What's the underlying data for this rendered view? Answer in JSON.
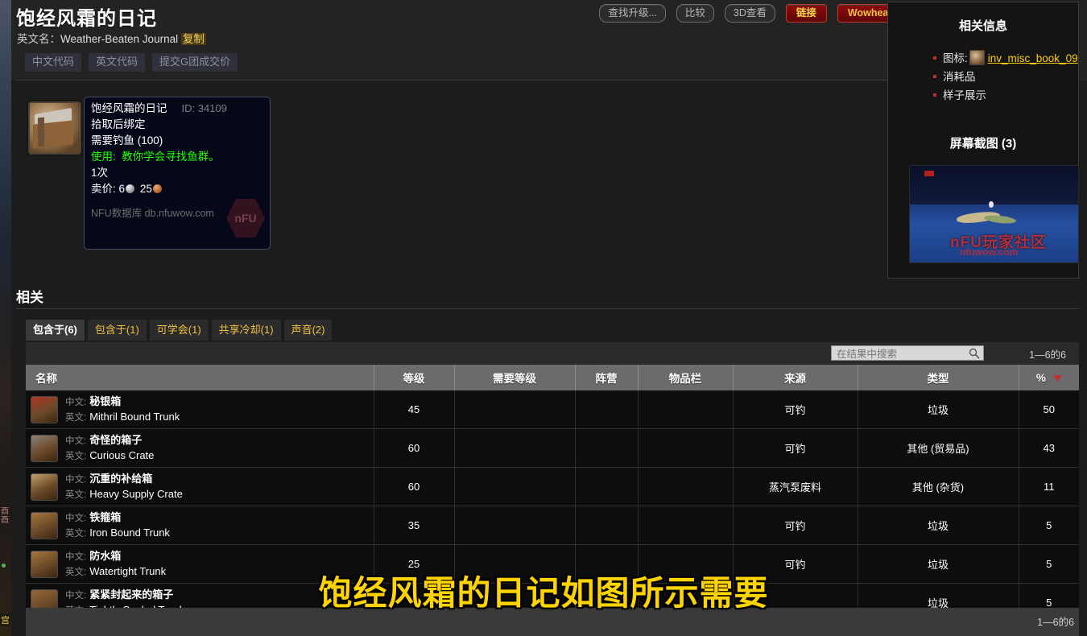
{
  "header": {
    "title": "饱经风霜的日记",
    "en_label": "英文名：",
    "en_name": "Weather-Beaten Journal",
    "copy_label": "复制",
    "code_buttons": [
      "中文代码",
      "英文代码",
      "提交G团成交价"
    ],
    "toolbar": [
      {
        "label": "查找升级...",
        "style": "plain"
      },
      {
        "label": "比较",
        "style": "plain"
      },
      {
        "label": "3D查看",
        "style": "plain"
      },
      {
        "label": "链接",
        "style": "red"
      },
      {
        "label": "Wowhead",
        "style": "red"
      }
    ]
  },
  "tooltip": {
    "icon_name": "inv-misc-book-icon",
    "name": "饱经风霜的日记",
    "id_label": "ID: 34109",
    "bind": "拾取后绑定",
    "requires": "需要钓鱼 (100)",
    "use_label": "使用:",
    "use_text": "教你学会寻找鱼群。",
    "charges": "1次",
    "sell_label": "卖价:",
    "sell_silver": "6",
    "sell_copper": "25",
    "source": "NFU数据库 db.nfuwow.com",
    "watermark": "nFU"
  },
  "right_panel": {
    "title": "相关信息",
    "items": [
      {
        "label": "图标:",
        "icon": true,
        "link": "inv_misc_book_09"
      },
      {
        "label": "消耗品",
        "icon": false,
        "link": ""
      },
      {
        "label": "样子展示",
        "icon": false,
        "link": ""
      }
    ],
    "screenshots_title": "屏幕截图 (3)",
    "thumb_watermark_1": "nFU玩家社区",
    "thumb_watermark_2": "nfuwow.com"
  },
  "related": {
    "heading": "相关",
    "tabs": [
      {
        "label": "包含于(6)",
        "active": true
      },
      {
        "label": "包含于(1)",
        "active": false
      },
      {
        "label": "可学会(1)",
        "active": false
      },
      {
        "label": "共享冷却(1)",
        "active": false
      },
      {
        "label": "声音(2)",
        "active": false
      }
    ],
    "search_placeholder": "在结果中搜索",
    "search_value": "",
    "result_count": "1—6的6",
    "footer_count": "1—6的6",
    "columns": [
      "名称",
      "等级",
      "需要等级",
      "阵营",
      "物品栏",
      "来源",
      "类型",
      "%"
    ],
    "sort_column": "%",
    "sort_direction": "desc",
    "name_cn_label": "中文:",
    "name_en_label": "英文:",
    "rows": [
      {
        "cn": "秘银箱",
        "en": "Mithril Bound Trunk",
        "level": "45",
        "req_level": "",
        "faction": "",
        "slot": "",
        "source": "可钓",
        "type": "垃圾",
        "pct": "50",
        "icon_color": "#b03626"
      },
      {
        "cn": "奇怪的箱子",
        "en": "Curious Crate",
        "level": "60",
        "req_level": "",
        "faction": "",
        "slot": "",
        "source": "可钓",
        "type": "其他 (贸易品)",
        "pct": "43",
        "icon_color": "#8b8379"
      },
      {
        "cn": "沉重的补给箱",
        "en": "Heavy Supply Crate",
        "level": "60",
        "req_level": "",
        "faction": "",
        "slot": "",
        "source": "蒸汽泵废料",
        "type": "其他 (杂货)",
        "pct": "11",
        "icon_color": "#c4a06a"
      },
      {
        "cn": "铁箍箱",
        "en": "Iron Bound Trunk",
        "level": "35",
        "req_level": "",
        "faction": "",
        "slot": "",
        "source": "可钓",
        "type": "垃圾",
        "pct": "5",
        "icon_color": "#a8763f"
      },
      {
        "cn": "防水箱",
        "en": "Watertight Trunk",
        "level": "25",
        "req_level": "",
        "faction": "",
        "slot": "",
        "source": "可钓",
        "type": "垃圾",
        "pct": "5",
        "icon_color": "#a8763f"
      },
      {
        "cn": "紧紧封起来的箱子",
        "en": "Tightly Sealed Trunk",
        "level": "",
        "req_level": "",
        "faction": "",
        "slot": "",
        "source": "",
        "type": "垃圾",
        "pct": "5",
        "icon_color": "#96673a"
      }
    ]
  },
  "caption": {
    "text": "饱经风霜的日记如图所示需要",
    "color": "#ffd400"
  }
}
